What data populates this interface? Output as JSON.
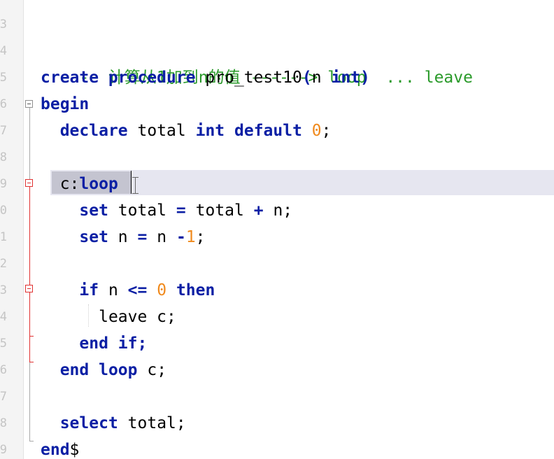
{
  "gutter": {
    "line_numbers": [
      "3",
      "4",
      "5",
      "6",
      "7",
      "8",
      "9",
      "0",
      "1",
      "2",
      "3",
      "4",
      "5",
      "6",
      "7",
      "8",
      "9"
    ]
  },
  "code": {
    "comment": "-- 计算从1加到n的值 ------> loop  ... leave",
    "line_create": {
      "kw": "create procedure",
      "name": "pro_test10",
      "open": "(",
      "param": "n",
      "type": "int",
      "close": ")"
    },
    "line_begin": {
      "kw": "begin"
    },
    "line_declare": {
      "kw1": "declare",
      "var": "total",
      "kw2": "int default",
      "value": "0",
      "end": ";"
    },
    "line_loop": {
      "label": "c:",
      "kw": "loop"
    },
    "line_set1": {
      "kw": "set",
      "lhs": "total",
      "op": "=",
      "a": "total",
      "plus": "+",
      "b": "n;"
    },
    "line_set2": {
      "kw": "set",
      "lhs": "n",
      "op": "=",
      "a": "n",
      "minus": "-",
      "value": "1",
      "end": ";"
    },
    "line_if": {
      "kw": "if",
      "var": "n",
      "op": "<=",
      "value": "0",
      "kw2": "then"
    },
    "line_leave": {
      "text": "leave c;"
    },
    "line_endif": {
      "kw": "end if",
      "end": ";"
    },
    "line_endloop": {
      "kw": "end loop",
      "label": "c;"
    },
    "line_select": {
      "kw": "select",
      "rest": "total;"
    },
    "line_end": {
      "kw": "end",
      "delim": "$"
    }
  },
  "colors": {
    "keyword": "#0b1fa4",
    "number": "#f08a1d",
    "comment": "#2a9a2a",
    "current_line": "#e6e6f0",
    "fold_marker_active": "#e03030"
  }
}
